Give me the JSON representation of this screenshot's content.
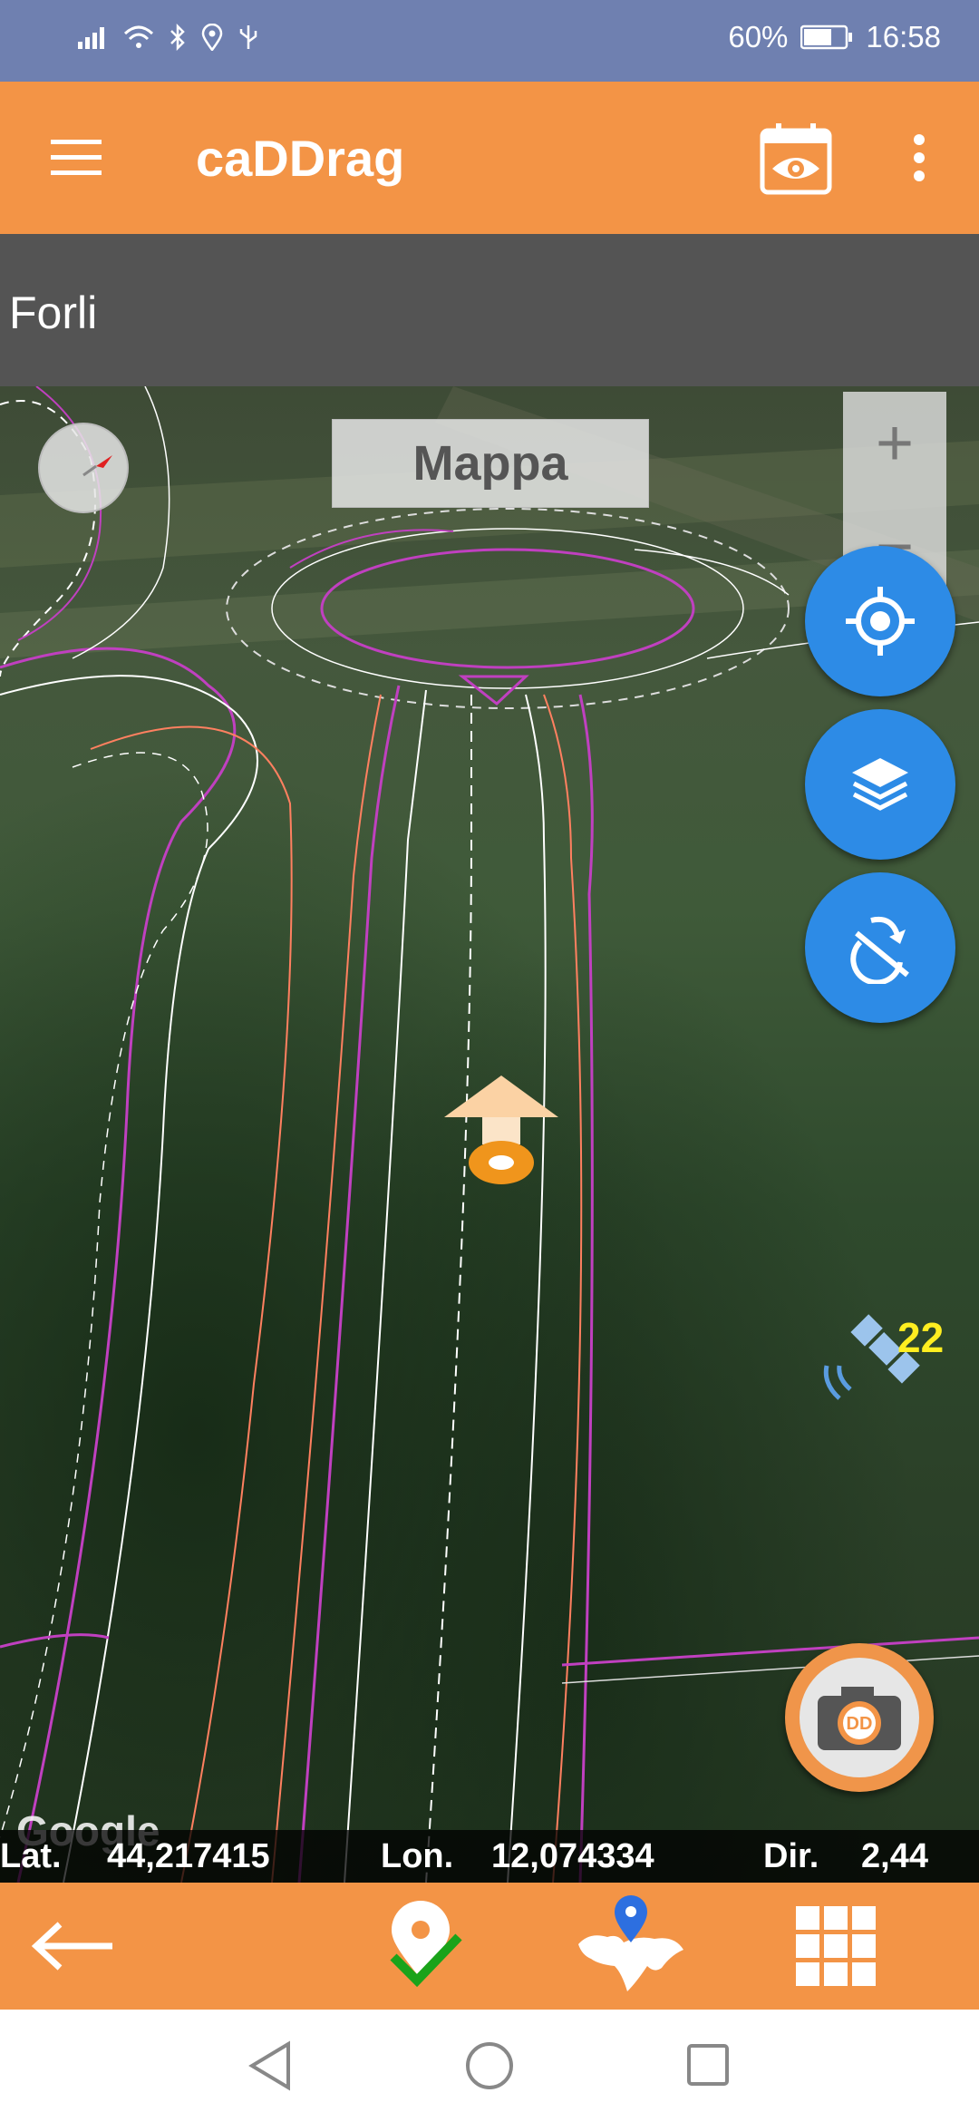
{
  "status_bar": {
    "battery": "60%",
    "time": "16:58"
  },
  "app_bar": {
    "title": "caDDrag"
  },
  "location": {
    "city": "Forli"
  },
  "map": {
    "mode_label": "Mappa",
    "zoom_in": "+",
    "zoom_out": "−",
    "satellite_count": "22",
    "attribution": "Google"
  },
  "coords": {
    "lat_label": "Lat.",
    "lat_value": "44,217415",
    "lon_label": "Lon.",
    "lon_value": "12,074334",
    "dir_label": "Dir.",
    "dir_value": "2,44"
  },
  "colors": {
    "primary": "#f39446",
    "status": "#6f80b0",
    "fab": "#2d8be6",
    "city_bar": "#545454"
  }
}
